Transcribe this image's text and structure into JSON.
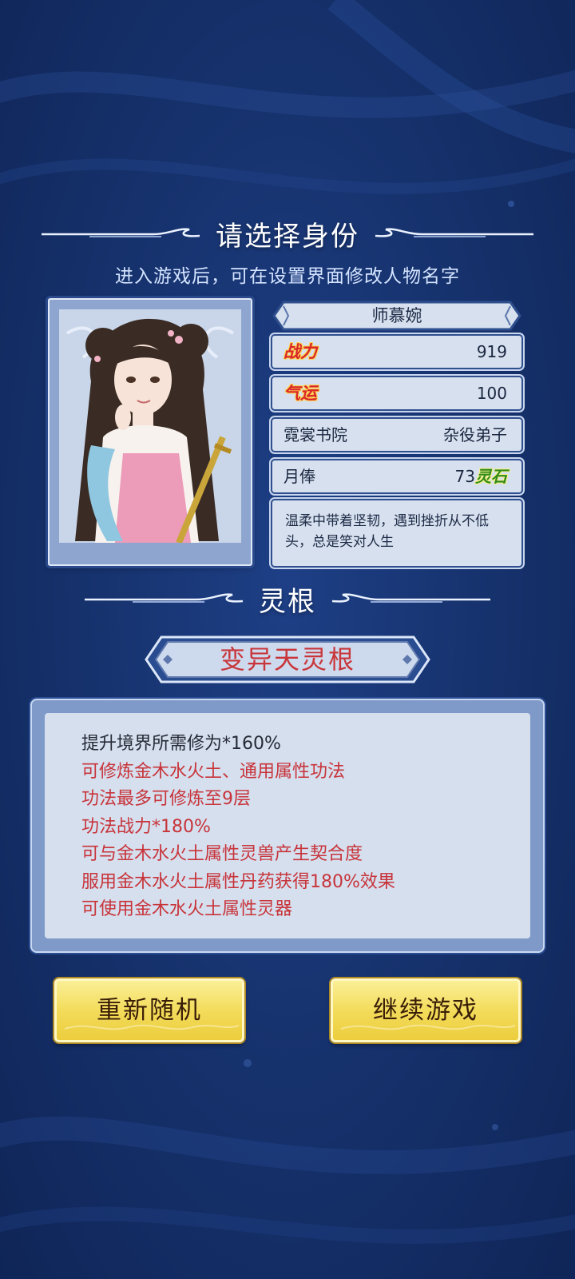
{
  "header": {
    "title": "请选择身份",
    "subtitle": "进入游戏后，可在设置界面修改人物名字"
  },
  "character": {
    "name": "师慕婉",
    "power": {
      "label": "战力",
      "value": "919"
    },
    "luck": {
      "label": "气运",
      "value": "100"
    },
    "faction": {
      "name": "霓裳书院",
      "rank": "杂役弟子"
    },
    "salary": {
      "label": "月俸",
      "value": "73",
      "unit": "灵石"
    },
    "description": "温柔中带着坚韧，遇到挫折从不低头，总是笑对人生"
  },
  "root_section": {
    "title": "灵根",
    "root_name": "变异天灵根",
    "effects": [
      "提升境界所需修为*160%",
      "可修炼金木水火土、通用属性功法",
      "功法最多可修炼至9层",
      "功法战力*180%",
      "可与金木水火土属性灵兽产生契合度",
      "服用金木水火土属性丹药获得180%效果",
      "可使用金木水火土属性灵器"
    ]
  },
  "buttons": {
    "reroll": "重新随机",
    "continue": "继续游戏"
  },
  "colors": {
    "background": "#17336f",
    "effect_red": "#c8343a",
    "button_gold": "#f3dc5b"
  }
}
